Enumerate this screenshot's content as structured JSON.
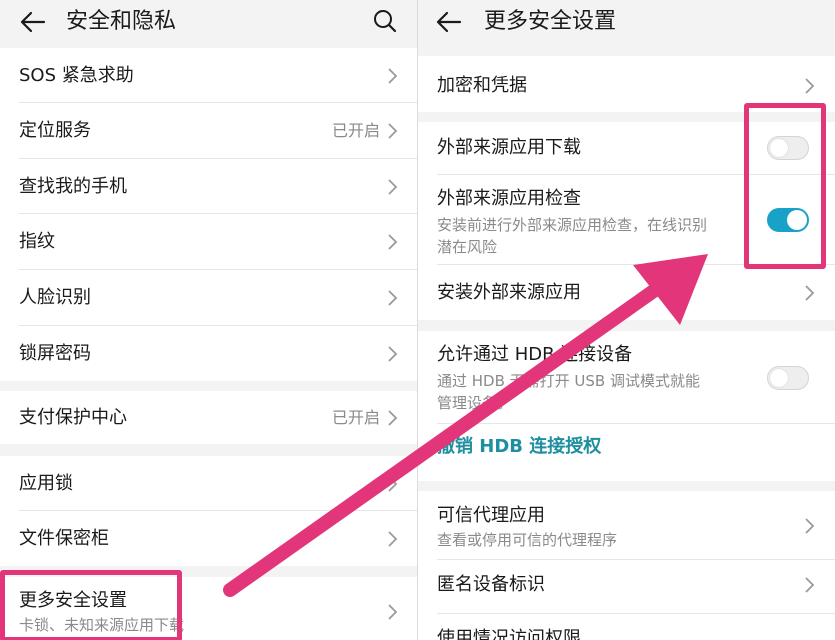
{
  "colors": {
    "accent": "#1e8fa0",
    "toggle_on": "#19a2c7",
    "highlight": "#e2357a"
  },
  "left": {
    "title": "安全和隐私",
    "back_icon": "back-arrow-icon",
    "search_icon": "search-icon",
    "groups": [
      [
        {
          "label": "SOS 紧急求助"
        },
        {
          "label": "定位服务",
          "value": "已开启"
        },
        {
          "label": "查找我的手机"
        },
        {
          "label": "指纹"
        },
        {
          "label": "人脸识别"
        },
        {
          "label": "锁屏密码"
        }
      ],
      [
        {
          "label": "支付保护中心",
          "value": "已开启"
        }
      ],
      [
        {
          "label": "应用锁"
        },
        {
          "label": "文件保密柜"
        }
      ],
      [
        {
          "label": "更多安全设置",
          "sub": "卡锁、未知来源应用下载"
        }
      ]
    ]
  },
  "right": {
    "title": "更多安全设置",
    "back_icon": "back-arrow-icon",
    "items": [
      {
        "label": "加密和凭据"
      },
      {
        "label": "外部来源应用下载",
        "toggle": "off"
      },
      {
        "label": "外部来源应用检查",
        "sub1": "安装前进行外部来源应用检查，在线识别",
        "sub2": "潜在风险",
        "toggle": "on"
      },
      {
        "label": "安装外部来源应用"
      },
      {
        "label": "允许通过 HDB 连接设备",
        "sub1": "通过 HDB 无需打开 USB 调试模式就能",
        "sub2": "管理设备。",
        "toggle": "off"
      },
      {
        "label": "撤销 HDB 连接授权"
      },
      {
        "label": "可信代理应用",
        "sub": "查看或停用可信的代理程序"
      },
      {
        "label": "匿名设备标识"
      },
      {
        "label": "使用情况访问权限"
      }
    ]
  }
}
